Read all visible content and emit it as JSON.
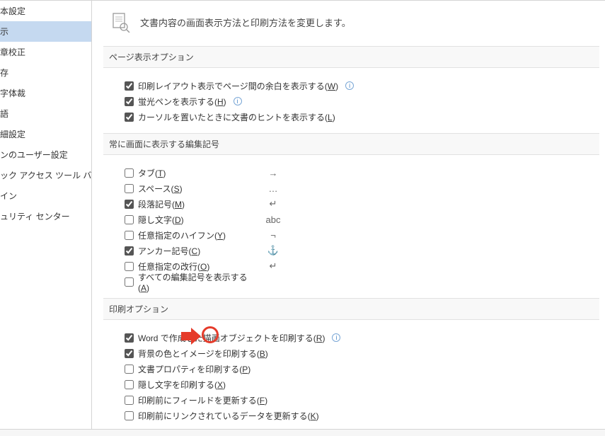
{
  "header": {
    "title": "文書内容の画面表示方法と印刷方法を変更します。"
  },
  "sidebar": {
    "items": [
      {
        "label": "本設定"
      },
      {
        "label": "示"
      },
      {
        "label": "章校正"
      },
      {
        "label": "存"
      },
      {
        "label": "字体裁"
      },
      {
        "label": "語"
      },
      {
        "label": "細設定"
      },
      {
        "label": "ンのユーザー設定"
      },
      {
        "label": "ック アクセス ツール バー"
      },
      {
        "label": "イン"
      },
      {
        "label": "ュリティ センター"
      }
    ],
    "selectedIndex": 1
  },
  "sections": {
    "pageDisplay": {
      "title": "ページ表示オプション",
      "opts": [
        {
          "label": "印刷レイアウト表示でページ間の余白を表示する(",
          "key": "W",
          "checked": true,
          "info": true
        },
        {
          "label": "蛍光ペンを表示する(",
          "key": "H",
          "checked": true,
          "info": true
        },
        {
          "label": "カーソルを置いたときに文書のヒントを表示する(",
          "key": "L",
          "checked": true,
          "info": false
        }
      ]
    },
    "marks": {
      "title": "常に画面に表示する編集記号",
      "opts": [
        {
          "label": "タブ(",
          "key": "T",
          "checked": false,
          "mark": "→"
        },
        {
          "label": "スペース(",
          "key": "S",
          "checked": false,
          "mark": "…"
        },
        {
          "label": "段落記号(",
          "key": "M",
          "checked": true,
          "mark": "↵"
        },
        {
          "label": "隠し文字(",
          "key": "D",
          "checked": false,
          "mark": "abc"
        },
        {
          "label": "任意指定のハイフン(",
          "key": "Y",
          "checked": false,
          "mark": "¬"
        },
        {
          "label": "アンカー記号(",
          "key": "C",
          "checked": true,
          "mark": "⚓"
        },
        {
          "label": "任意指定の改行(",
          "key": "O",
          "checked": false,
          "mark": "↵"
        },
        {
          "label": "すべての編集記号を表示する(",
          "key": "A",
          "checked": false,
          "mark": ""
        }
      ]
    },
    "print": {
      "title": "印刷オプション",
      "opts": [
        {
          "label": "Word で作成した描画オブジェクトを印刷する(",
          "key": "R",
          "checked": true,
          "info": true
        },
        {
          "label": "背景の色とイメージを印刷する(",
          "key": "B",
          "checked": true,
          "info": false
        },
        {
          "label": "文書プロパティを印刷する(",
          "key": "P",
          "checked": false,
          "info": false
        },
        {
          "label": "隠し文字を印刷する(",
          "key": "X",
          "checked": false,
          "info": false
        },
        {
          "label": "印刷前にフィールドを更新する(",
          "key": "F",
          "checked": false,
          "info": false
        },
        {
          "label": "印刷前にリンクされているデータを更新する(",
          "key": "K",
          "checked": false,
          "info": false
        }
      ]
    }
  }
}
